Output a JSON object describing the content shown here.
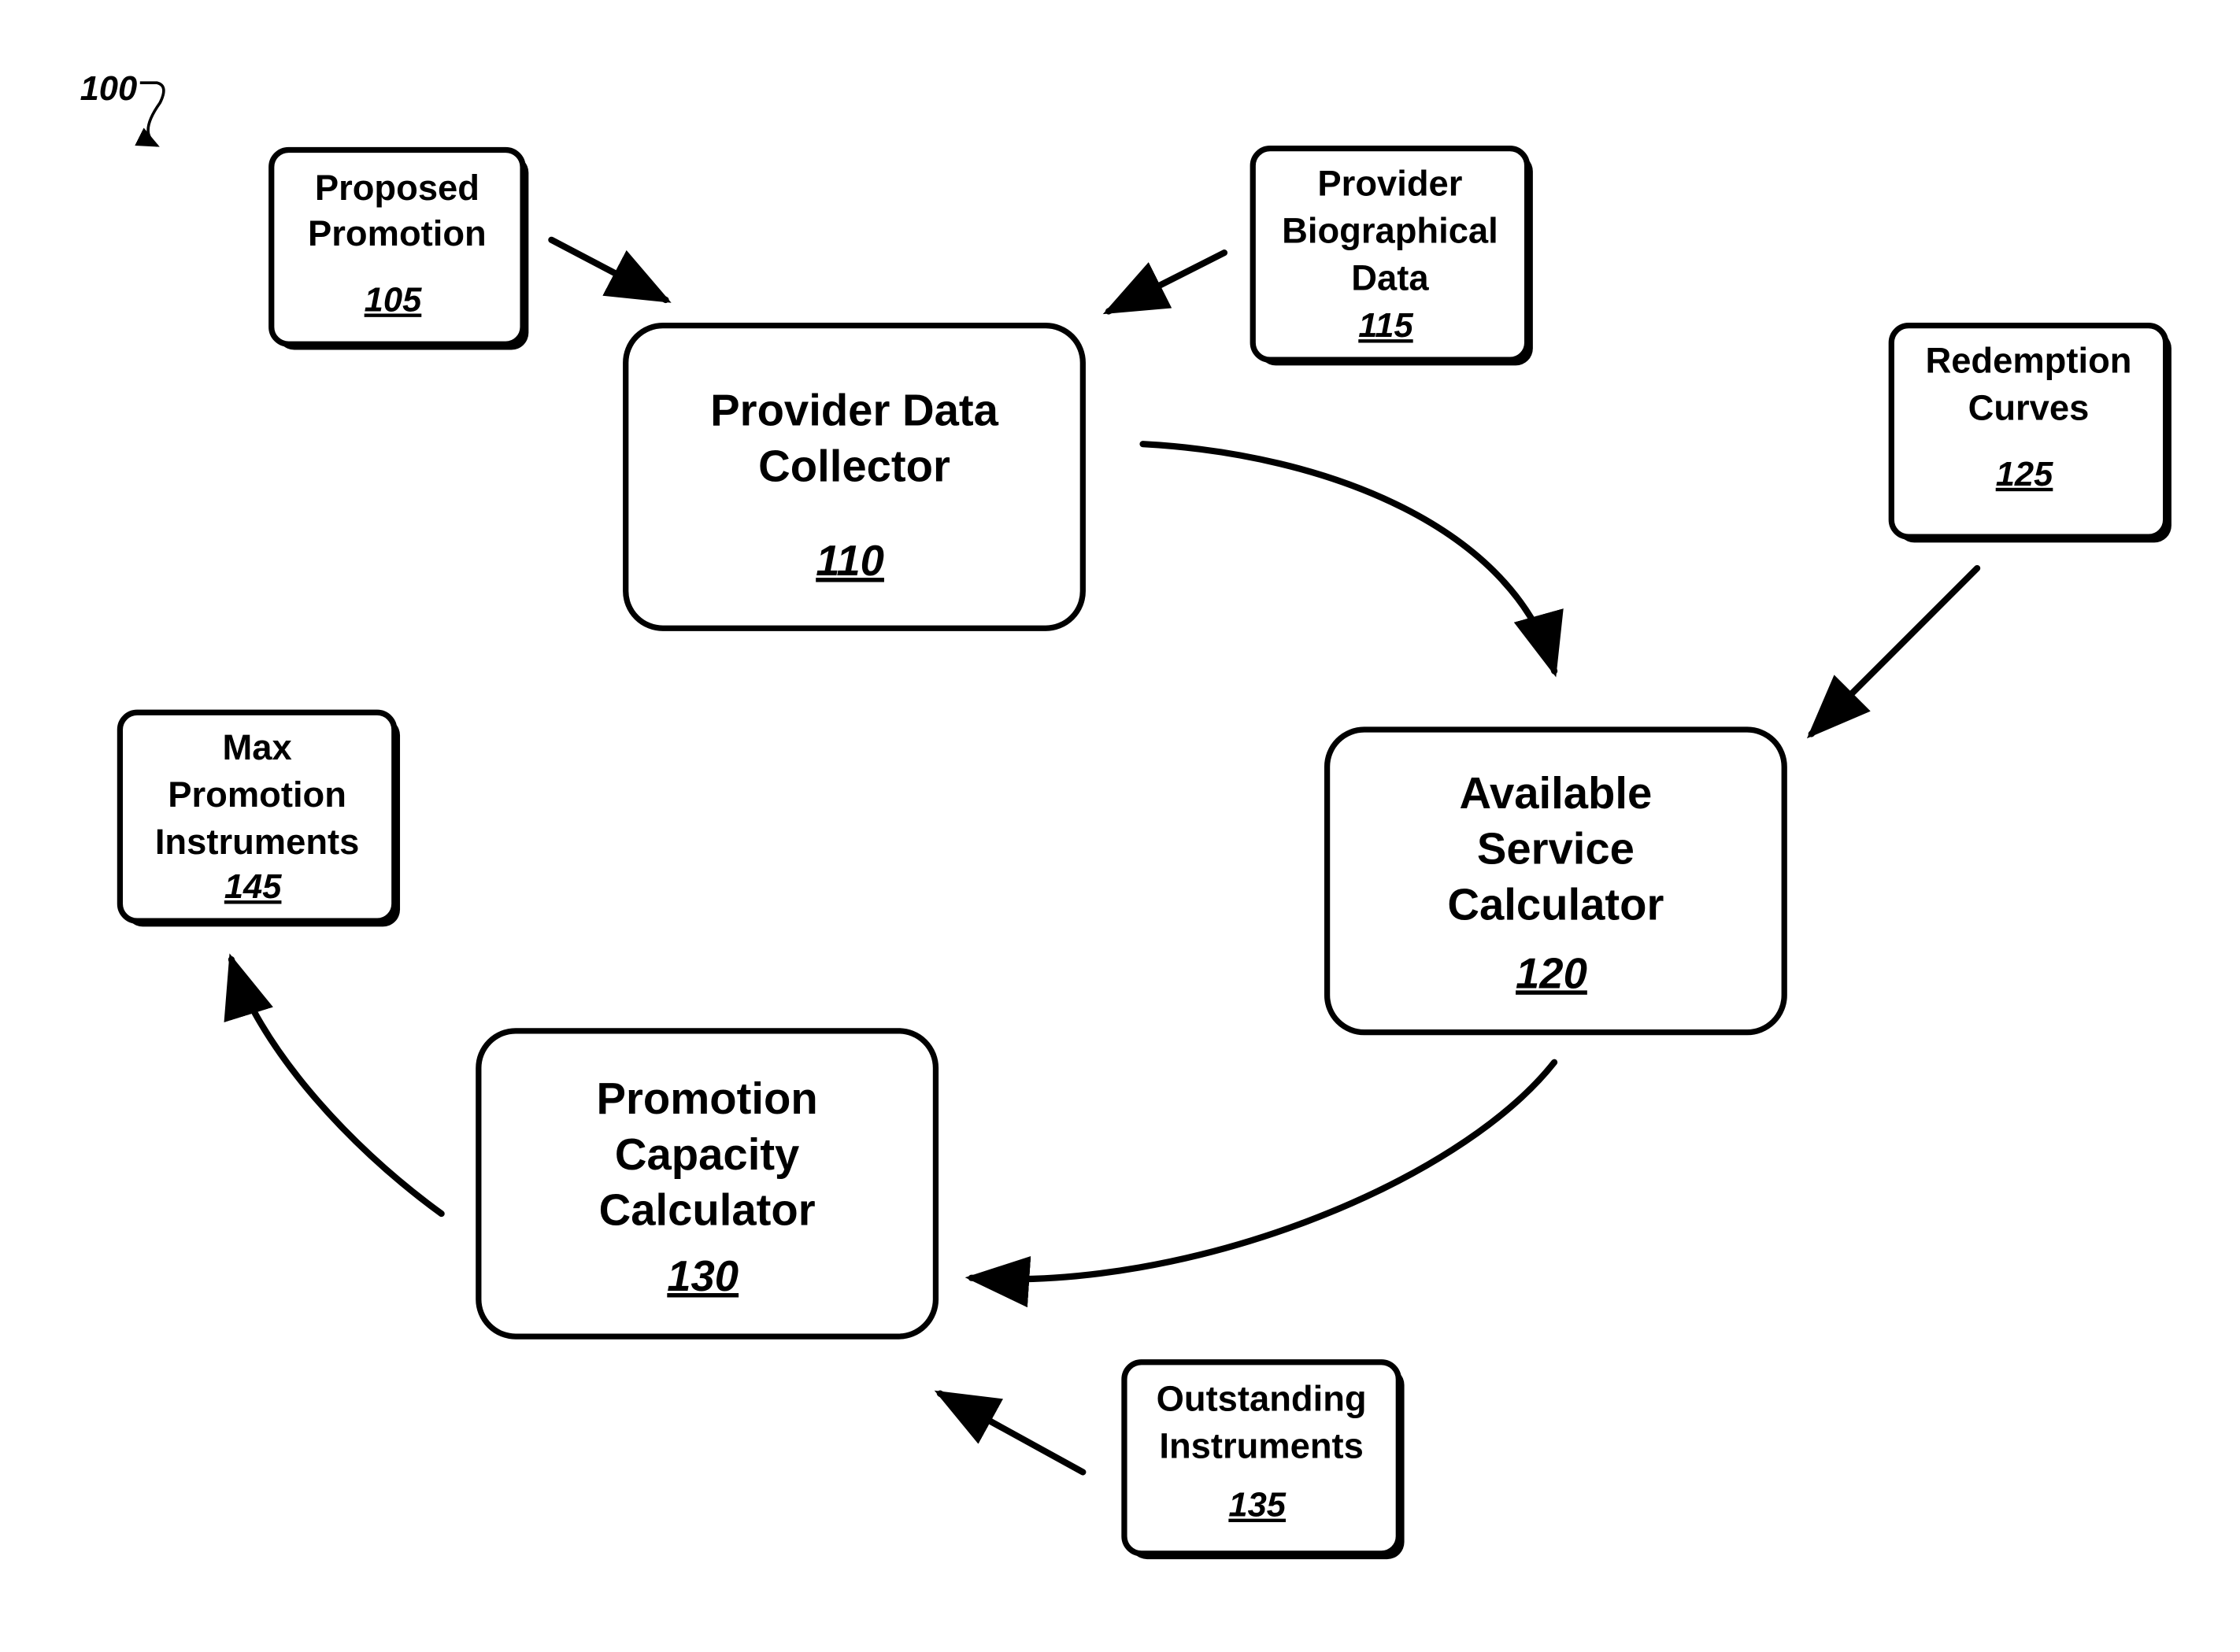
{
  "figure": {
    "label": "100",
    "colors": {
      "ink": "#000000",
      "background": "#ffffff"
    }
  },
  "nodes": [
    {
      "id": "proposed-promotion",
      "lines": [
        "Proposed",
        "Promotion"
      ],
      "ref": "105",
      "kind": "input"
    },
    {
      "id": "provider-data-collector",
      "lines": [
        "Provider Data",
        "Collector"
      ],
      "ref": "110",
      "kind": "module"
    },
    {
      "id": "provider-biographical-data",
      "lines": [
        "Provider",
        "Biographical",
        "Data"
      ],
      "ref": "115",
      "kind": "input"
    },
    {
      "id": "available-service-calculator",
      "lines": [
        "Available",
        "Service",
        "Calculator"
      ],
      "ref": "120",
      "kind": "module"
    },
    {
      "id": "redemption-curves",
      "lines": [
        "Redemption",
        "Curves"
      ],
      "ref": "125",
      "kind": "input"
    },
    {
      "id": "promotion-capacity-calculator",
      "lines": [
        "Promotion",
        "Capacity",
        "Calculator"
      ],
      "ref": "130",
      "kind": "module"
    },
    {
      "id": "outstanding-instruments",
      "lines": [
        "Outstanding",
        "Instruments"
      ],
      "ref": "135",
      "kind": "input"
    },
    {
      "id": "max-promotion-instruments",
      "lines": [
        "Max",
        "Promotion",
        "Instruments"
      ],
      "ref": "145",
      "kind": "output"
    }
  ],
  "edges": [
    {
      "from": "105",
      "to": "110"
    },
    {
      "from": "115",
      "to": "110"
    },
    {
      "from": "110",
      "to": "120"
    },
    {
      "from": "125",
      "to": "120"
    },
    {
      "from": "120",
      "to": "130"
    },
    {
      "from": "135",
      "to": "130"
    },
    {
      "from": "130",
      "to": "145"
    }
  ]
}
